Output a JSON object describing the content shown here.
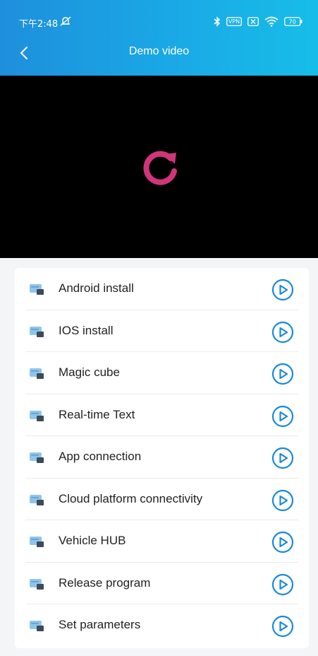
{
  "status_bar": {
    "time": "下午2:48",
    "icons": [
      "mute-icon",
      "bluetooth-icon",
      "vpn-icon",
      "sim-off-icon",
      "wifi-icon",
      "battery-icon"
    ],
    "vpn_label": "VPN",
    "battery_level": "70"
  },
  "header": {
    "title": "Demo video",
    "back_icon": "chevron-left-icon",
    "gradient": [
      "#1e8fdc",
      "#17bde8"
    ]
  },
  "video": {
    "state_icon": "replay-icon",
    "replay_color": "#d0357a"
  },
  "list": {
    "item_icon": "video-file-icon",
    "action_icon": "play-circle-icon",
    "accent_color": "#1a8ad8",
    "items": [
      {
        "label": "Android install"
      },
      {
        "label": "IOS install"
      },
      {
        "label": "Magic cube"
      },
      {
        "label": "Real-time Text"
      },
      {
        "label": "App connection"
      },
      {
        "label": "Cloud platform connectivity"
      },
      {
        "label": "Vehicle HUB"
      },
      {
        "label": "Release program"
      },
      {
        "label": "Set parameters"
      }
    ]
  }
}
